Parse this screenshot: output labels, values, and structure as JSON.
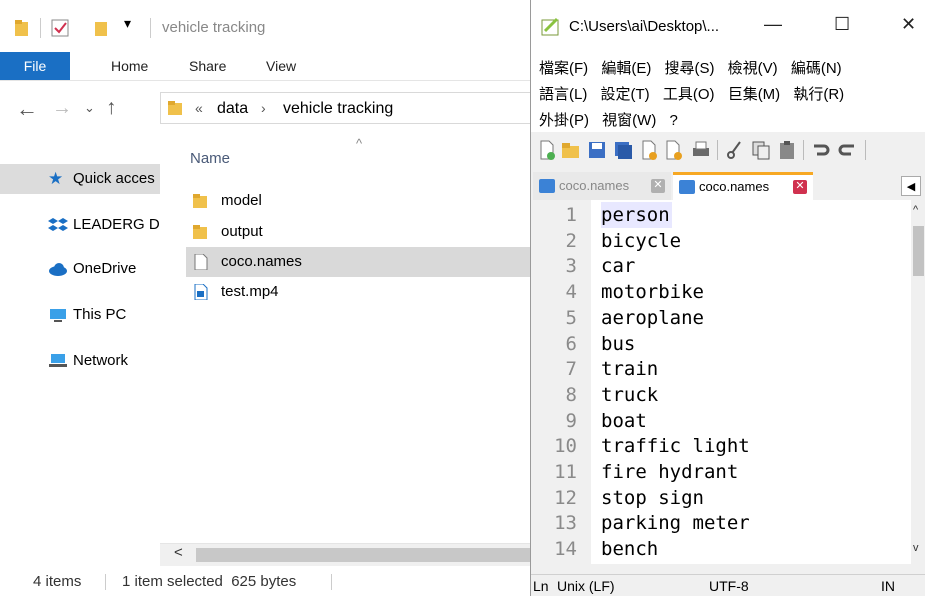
{
  "explorer": {
    "title": "vehicle tracking",
    "ribbon_tabs": [
      "File",
      "Home",
      "Share",
      "View"
    ],
    "breadcrumb": {
      "prefix": "«",
      "items": [
        "data",
        "vehicle tracking"
      ]
    },
    "nav": [
      "Quick acces",
      "LEADERG D",
      "OneDrive",
      "This PC",
      "Network"
    ],
    "column_header": "Name",
    "files": [
      {
        "name": "model",
        "type": "folder"
      },
      {
        "name": "output",
        "type": "folder"
      },
      {
        "name": "coco.names",
        "type": "file",
        "selected": true
      },
      {
        "name": "test.mp4",
        "type": "video"
      }
    ],
    "status": {
      "count": "4 items",
      "selection": "1 item selected  625 bytes"
    }
  },
  "npp": {
    "title": "C:\\Users\\ai\\Desktop\\...",
    "window_buttons": {
      "minimize": "—",
      "maximize": "☐",
      "close": "✕"
    },
    "menu_row1": [
      "檔案(F)",
      "編輯(E)",
      "搜尋(S)",
      "檢視(V)",
      "編碼(N)"
    ],
    "menu_row2": [
      "語言(L)",
      "設定(T)",
      "工具(O)",
      "巨集(M)",
      "執行(R)"
    ],
    "menu_row3": [
      "外掛(P)",
      "視窗(W)",
      "?"
    ],
    "tabs": [
      "coco.names",
      "coco.names"
    ],
    "lines": [
      {
        "n": "1",
        "text": "person"
      },
      {
        "n": "2",
        "text": "bicycle"
      },
      {
        "n": "3",
        "text": "car"
      },
      {
        "n": "4",
        "text": "motorbike"
      },
      {
        "n": "5",
        "text": "aeroplane"
      },
      {
        "n": "6",
        "text": "bus"
      },
      {
        "n": "7",
        "text": "train"
      },
      {
        "n": "8",
        "text": "truck"
      },
      {
        "n": "9",
        "text": "boat"
      },
      {
        "n": "10",
        "text": "traffic light"
      },
      {
        "n": "11",
        "text": "fire hydrant"
      },
      {
        "n": "12",
        "text": "stop sign"
      },
      {
        "n": "13",
        "text": "parking meter"
      },
      {
        "n": "14",
        "text": "bench"
      }
    ],
    "status": {
      "ln": "Ln",
      "eol": "Unix (LF)",
      "encoding": "UTF-8",
      "mode": "IN"
    }
  },
  "colors": {
    "accent": "#1a6fc4",
    "folder": "#f0c14b",
    "tab_active": "#f7a823",
    "close_red": "#d0314f"
  }
}
